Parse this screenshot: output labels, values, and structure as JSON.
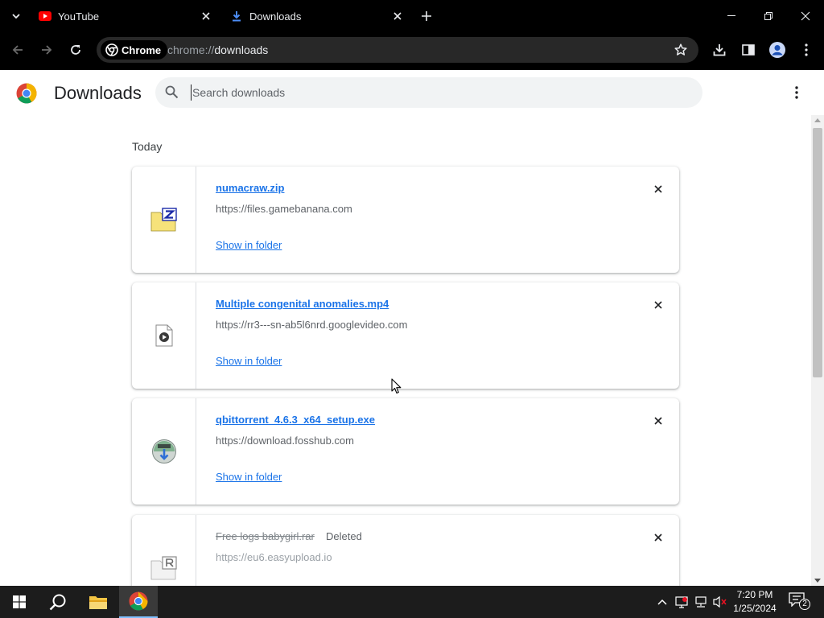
{
  "browser": {
    "tabs": [
      {
        "title": "YouTube",
        "active": false
      },
      {
        "title": "Downloads",
        "active": true
      }
    ],
    "omnibox": {
      "chip_label": "Chrome",
      "url_scheme": "chrome://",
      "url_host": "downloads"
    }
  },
  "downloads_page": {
    "title": "Downloads",
    "search_placeholder": "Search downloads",
    "section_label": "Today",
    "items": [
      {
        "filename": "numacraw.zip",
        "source": "https://files.gamebanana.com",
        "action": "Show in folder",
        "icon": "zip-file-icon"
      },
      {
        "filename": "Multiple congenital anomalies.mp4",
        "source": "https://rr3---sn-ab5l6nrd.googlevideo.com",
        "action": "Show in folder",
        "icon": "video-file-icon"
      },
      {
        "filename": "qbittorrent_4.6.3_x64_setup.exe",
        "source": "https://download.fosshub.com",
        "action": "Show in folder",
        "icon": "installer-icon"
      },
      {
        "filename": "Free logs babygirl.rar",
        "status": "Deleted",
        "source": "https://eu6.easyupload.io",
        "icon": "rar-file-icon"
      }
    ]
  },
  "taskbar": {
    "time": "7:20 PM",
    "date": "1/25/2024",
    "notification_count": "2"
  },
  "colors": {
    "link_blue": "#1a73e8",
    "chrome_dark": "#000000",
    "taskbar": "#1c1c1c"
  }
}
